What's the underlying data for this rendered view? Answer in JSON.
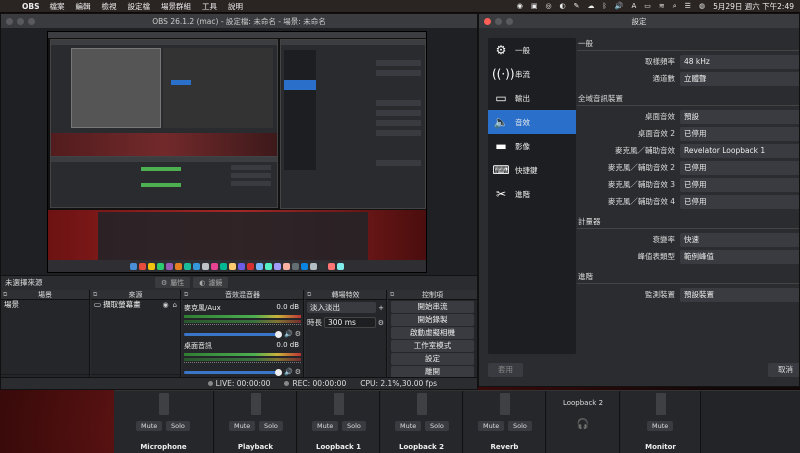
{
  "menubar": {
    "apple": "",
    "app": "OBS",
    "items": [
      "檔案",
      "編輯",
      "檢視",
      "設定檔",
      "場景群組",
      "工具",
      "說明"
    ],
    "clock": "5月29日 週六 下午2:49"
  },
  "obs_window": {
    "title": "OBS 26.1.2 (mac) - 設定檔: 未命名 - 場景: 未命名"
  },
  "docks": {
    "no_source": "未選擇來源",
    "props_button": "屬性",
    "filters_button": "濾鏡",
    "scenes": {
      "title": "場景",
      "items": [
        "場景"
      ]
    },
    "sources": {
      "title": "來源",
      "items": [
        "擷取螢幕畫"
      ]
    },
    "mixer": {
      "title": "音效混音器",
      "channels": [
        {
          "name": "麥克風/Aux",
          "db": "0.0 dB"
        },
        {
          "name": "桌面音訊",
          "db": "0.0 dB"
        }
      ]
    },
    "transitions": {
      "title": "轉場特效",
      "type": "淡入淡出",
      "duration_label": "時長",
      "duration": "300 ms"
    },
    "controls": {
      "title": "控制項",
      "buttons": [
        "開始串流",
        "開始錄製",
        "啟動虛擬相機",
        "工作室模式",
        "設定",
        "離開"
      ]
    }
  },
  "status": {
    "live": "LIVE: 00:00:00",
    "rec": "REC: 00:00:00",
    "cpu": "CPU: 2.1%,30.00 fps"
  },
  "settings": {
    "title": "設定",
    "sidebar": [
      {
        "label": "一般",
        "icon": "gear-icon"
      },
      {
        "label": "串流",
        "icon": "antenna-icon"
      },
      {
        "label": "輸出",
        "icon": "output-icon"
      },
      {
        "label": "音效",
        "icon": "speaker-icon"
      },
      {
        "label": "影像",
        "icon": "monitor-icon"
      },
      {
        "label": "快捷鍵",
        "icon": "keyboard-icon"
      },
      {
        "label": "進階",
        "icon": "tools-icon"
      }
    ],
    "general": {
      "title": "一般",
      "rows": [
        {
          "label": "取樣頻率",
          "value": "48 kHz"
        },
        {
          "label": "通道數",
          "value": "立體聲"
        }
      ]
    },
    "global_devices": {
      "title": "全域音訊裝置",
      "rows": [
        {
          "label": "桌面音效",
          "value": "預設"
        },
        {
          "label": "桌面音效 2",
          "value": "已停用"
        },
        {
          "label": "麥克風／輔助音效",
          "value": "Revelator Loopback 1"
        },
        {
          "label": "麥克風／輔助音效 2",
          "value": "已停用"
        },
        {
          "label": "麥克風／輔助音效 3",
          "value": "已停用"
        },
        {
          "label": "麥克風／輔助音效 4",
          "value": "已停用"
        }
      ]
    },
    "meters": {
      "title": "計量器",
      "rows": [
        {
          "label": "衰變率",
          "value": "快速"
        },
        {
          "label": "峰值表類型",
          "value": "範例峰值"
        }
      ]
    },
    "advanced": {
      "title": "進階",
      "rows": [
        {
          "label": "監測裝置",
          "value": "預設裝置"
        }
      ]
    },
    "apply_button": "套用",
    "cancel_button": "取消"
  },
  "bg_mixer": {
    "mute": "Mute",
    "solo": "Solo",
    "channels": [
      "Microphone",
      "Playback",
      "Loopback 1",
      "Loopback 2",
      "Reverb",
      "",
      "Monitor"
    ],
    "loopback2_top": "Loopback 2"
  }
}
